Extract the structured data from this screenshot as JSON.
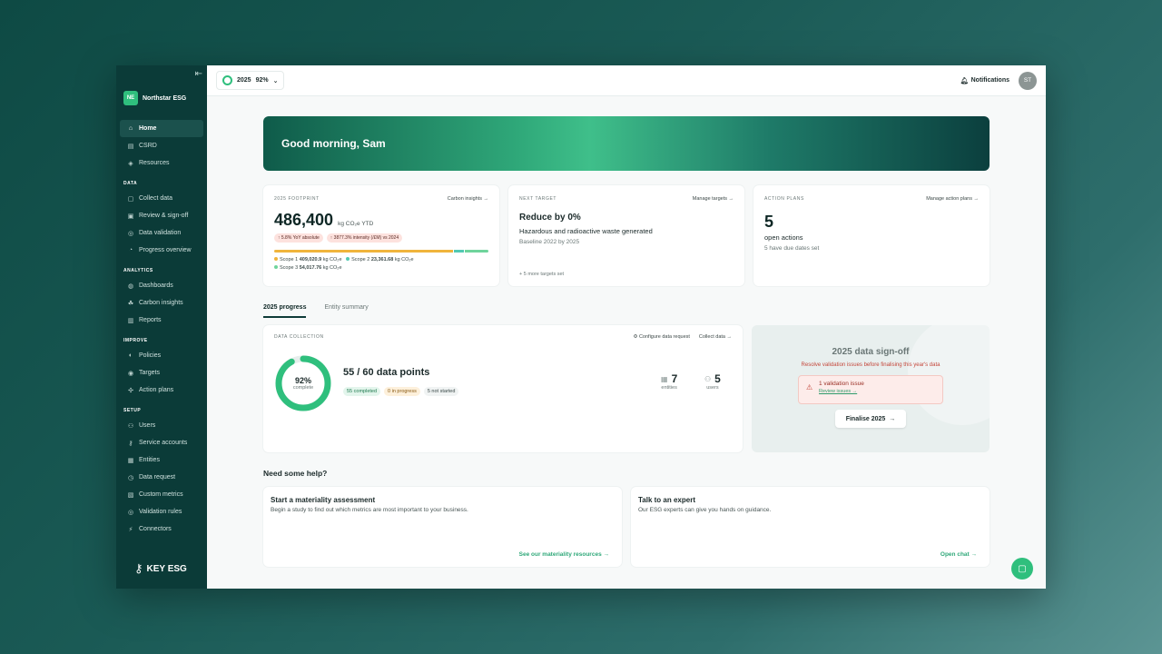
{
  "sidebar": {
    "brand_initials": "NE",
    "brand_name": "Northstar ESG",
    "home": "Home",
    "csrd": "CSRD",
    "resources": "Resources",
    "sections": {
      "data": "DATA",
      "analytics": "ANALYTICS",
      "improve": "IMPROVE",
      "setup": "SETUP"
    },
    "data_items": [
      "Collect data",
      "Review & sign-off",
      "Data validation",
      "Progress overview"
    ],
    "analytics_items": [
      "Dashboards",
      "Carbon insights",
      "Reports"
    ],
    "improve_items": [
      "Policies",
      "Targets",
      "Action plans"
    ],
    "setup_items": [
      "Users",
      "Service accounts",
      "Entities",
      "Data request",
      "Custom metrics",
      "Validation rules",
      "Connectors"
    ],
    "footer_logo": "KEY ESG"
  },
  "topbar": {
    "year": "2025",
    "percent": "92%",
    "notifications": "Notifications",
    "avatar": "ST"
  },
  "banner": {
    "greeting": "Good morning, Sam"
  },
  "footprint": {
    "label": "2025 FOOTPRINT",
    "link": "Carbon insights →",
    "value": "486,400",
    "unit": "kg CO₂e YTD",
    "pill1": "↑ 5.8% YoY absolute",
    "pill2": "↑ 3877.3% intensity (/£M) vs 2024",
    "scope1_label": "Scope 1",
    "scope1_value": "409,020.9",
    "scope2_label": "Scope 2",
    "scope2_value": "23,361.68",
    "scope3_label": "Scope 3",
    "scope3_value": "54,017.76",
    "unit_short": "kg CO₂e",
    "scope1_color": "#f0b43c",
    "scope2_color": "#52c9b3",
    "scope3_color": "#6fd49c"
  },
  "target": {
    "label": "NEXT TARGET",
    "link": "Manage targets →",
    "title": "Reduce by 0%",
    "subtitle": "Hazardous and radioactive waste generated",
    "baseline": "Baseline 2022 by 2025",
    "more": "+ 5 more targets set"
  },
  "actions": {
    "label": "ACTION PLANS",
    "link": "Manage action plans →",
    "count": "5",
    "title": "open actions",
    "subtitle": "5 have due dates set"
  },
  "tabs": [
    "2025 progress",
    "Entity summary"
  ],
  "collection": {
    "label": "DATA COLLECTION",
    "configure": "Configure data request",
    "collect": "Collect data →",
    "percent": "92%",
    "percent_value": 0.92,
    "complete": "complete",
    "points": "55 / 60 data points",
    "completed": "55 completed",
    "in_progress": "0 in progress",
    "not_started": "5 not started",
    "entities_count": "7",
    "entities_label": "entities",
    "users_count": "5",
    "users_label": "users"
  },
  "signoff": {
    "title": "2025 data sign-off",
    "warning": "Resolve validation issues before finalising this year's data",
    "issue": "1 validation issue",
    "review": "Review issues →",
    "button": "Finalise 2025"
  },
  "help": {
    "title": "Need some help?",
    "card1_title": "Start a materiality assessment",
    "card1_text": "Begin a study to find out which metrics are most important to your business.",
    "card1_link": "See our materiality resources →",
    "card2_title": "Talk to an expert",
    "card2_text": "Our ESG experts can give you hands on guidance.",
    "card2_link": "Open chat →"
  },
  "colors": {
    "accent": "#2fbf7d",
    "sidebar": "#0b3b38"
  }
}
